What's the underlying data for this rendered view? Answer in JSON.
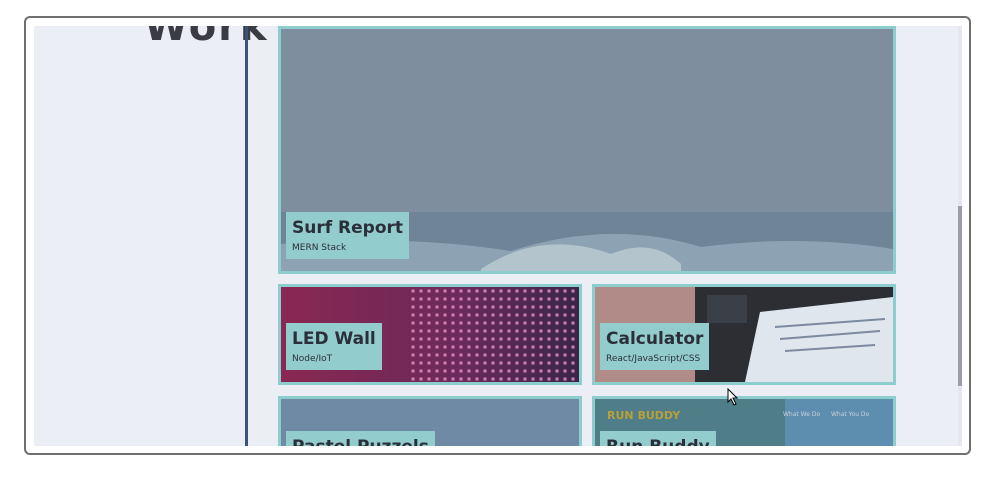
{
  "page": {
    "faded_heading": "Work"
  },
  "projects": [
    {
      "title": "Surf Report",
      "subtitle": "MERN Stack"
    },
    {
      "title": "LED Wall",
      "subtitle": "Node/IoT"
    },
    {
      "title": "Calculator",
      "subtitle": "React/JavaScript/CSS"
    },
    {
      "title": "Pastel Puzzels",
      "subtitle": ""
    },
    {
      "title": "Run Buddy",
      "subtitle": ""
    }
  ],
  "run_buddy_preview": {
    "brand": "RUN BUDDY",
    "nav_1": "What We Do",
    "nav_2": "What You Do"
  },
  "colors": {
    "card_border": "#8ecdcd",
    "label_bg": "#92cccd",
    "divider": "#3c527a",
    "background": "#eceef6"
  }
}
